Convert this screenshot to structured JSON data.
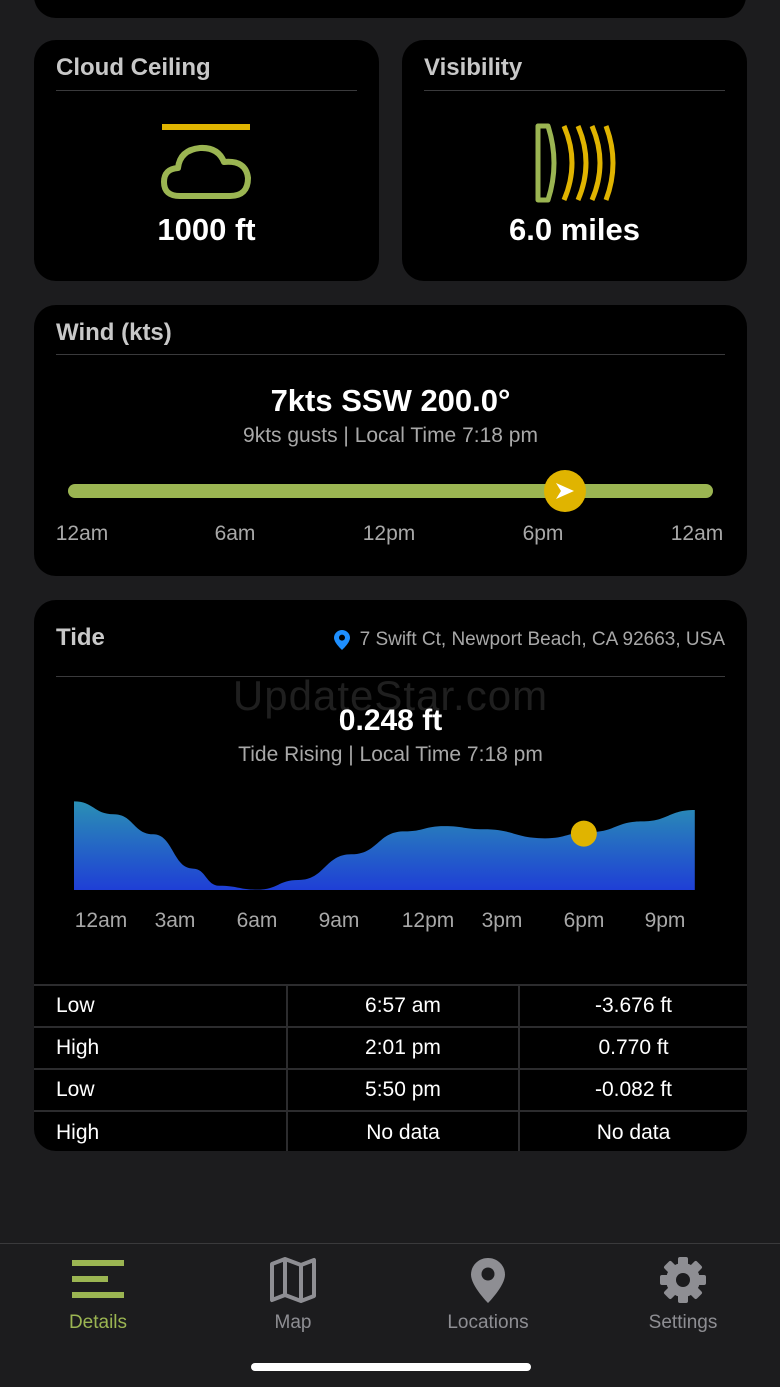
{
  "cloud_ceiling": {
    "title": "Cloud Ceiling",
    "value": "1000 ft",
    "icon": "cloud-ceiling-icon"
  },
  "visibility": {
    "title": "Visibility",
    "value": "6.0 miles",
    "icon": "visibility-icon"
  },
  "wind": {
    "title": "Wind (kts)",
    "main": "7kts SSW 200.0°",
    "sub": "9kts gusts | Local Time 7:18 pm",
    "time_progress": 0.77,
    "ticks": [
      "12am",
      "6am",
      "12pm",
      "6pm",
      "12am"
    ],
    "colors": {
      "track": "#9bb552",
      "thumb": "#e0b400"
    }
  },
  "tide": {
    "title": "Tide",
    "location": "7 Swift Ct, Newport Beach, CA 92663, USA",
    "watermark": "UpdateStar.com",
    "main": "0.248 ft",
    "sub": "Tide Rising | Local Time 7:18 pm",
    "ticks": [
      "12am",
      "3am",
      "6am",
      "9am",
      "12pm",
      "3pm",
      "6pm",
      "9pm"
    ],
    "chart_data": {
      "type": "area",
      "x_hours": [
        0,
        1.5,
        3,
        4.5,
        5.5,
        6.95,
        8.5,
        10.5,
        12.5,
        14.02,
        15.5,
        17.83,
        19.5,
        21.5,
        23.5
      ],
      "y_ft": [
        2.5,
        1.6,
        0.2,
        -2.2,
        -3.4,
        -3.676,
        -3.0,
        -1.2,
        0.4,
        0.77,
        0.55,
        -0.082,
        0.35,
        1.1,
        1.9
      ],
      "current": {
        "hour": 19.3,
        "value": 0.248
      },
      "ylim": [
        -3.7,
        2.6
      ],
      "colors": {
        "top": "#2a8fb4",
        "bottom": "#1f3fd6",
        "marker": "#e0b400"
      }
    },
    "table": [
      {
        "type": "Low",
        "time": "6:57 am",
        "height": "-3.676 ft"
      },
      {
        "type": "High",
        "time": "2:01 pm",
        "height": "0.770 ft"
      },
      {
        "type": "Low",
        "time": "5:50 pm",
        "height": "-0.082 ft"
      },
      {
        "type": "High",
        "time": "No data",
        "height": "No data"
      }
    ]
  },
  "tabs": [
    {
      "label": "Details",
      "icon": "details-icon",
      "active": true
    },
    {
      "label": "Map",
      "icon": "map-icon",
      "active": false
    },
    {
      "label": "Locations",
      "icon": "location-pin-icon",
      "active": false
    },
    {
      "label": "Settings",
      "icon": "gear-icon",
      "active": false
    }
  ],
  "colors": {
    "accent": "#9bb552",
    "card": "#000000",
    "background": "#1c1c1e",
    "muted": "#8e8e93"
  }
}
